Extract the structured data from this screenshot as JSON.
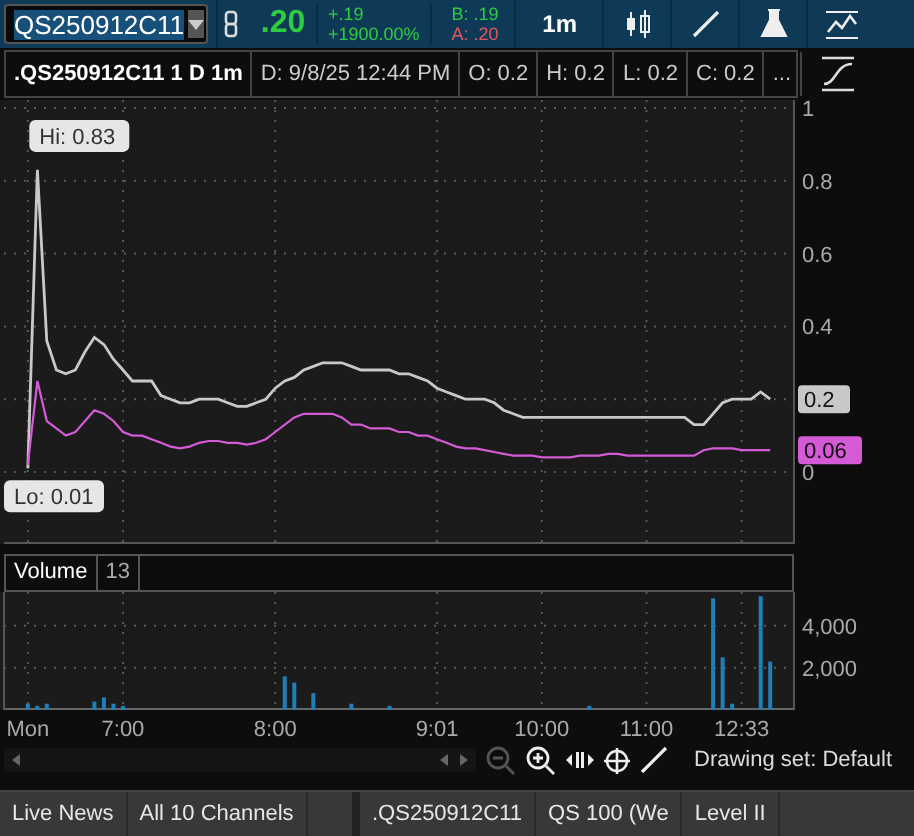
{
  "toolbar": {
    "symbol": "QS250912C11",
    "last": ".20",
    "change": "+.19",
    "change_pct": "+1900.00%",
    "bid": "B: .19",
    "ask": "A: .20",
    "interval": "1m"
  },
  "info_bar": {
    "title": ".QS250912C11 1 D 1m",
    "cells": [
      "D: 9/8/25 12:44 PM",
      "O: 0.2",
      "H: 0.2",
      "L: 0.2",
      "C: 0.2",
      "..."
    ]
  },
  "price_chart": {
    "chart_data": {
      "type": "line",
      "grid": true,
      "ylim": [
        0,
        1
      ],
      "yticks": [
        0,
        0.4,
        0.6,
        0.8,
        1
      ],
      "series": [
        {
          "color": "#c8c8c8",
          "values": [
            0.01,
            0.83,
            0.36,
            0.28,
            0.27,
            0.28,
            0.33,
            0.37,
            0.35,
            0.31,
            0.28,
            0.25,
            0.25,
            0.25,
            0.21,
            0.2,
            0.19,
            0.19,
            0.2,
            0.2,
            0.2,
            0.19,
            0.18,
            0.18,
            0.19,
            0.2,
            0.23,
            0.25,
            0.26,
            0.28,
            0.29,
            0.3,
            0.3,
            0.3,
            0.29,
            0.28,
            0.28,
            0.28,
            0.28,
            0.27,
            0.27,
            0.26,
            0.25,
            0.23,
            0.22,
            0.21,
            0.2,
            0.2,
            0.2,
            0.19,
            0.17,
            0.16,
            0.15,
            0.15,
            0.15,
            0.15,
            0.15,
            0.15,
            0.15,
            0.15,
            0.15,
            0.15,
            0.15,
            0.15,
            0.15,
            0.15,
            0.15,
            0.15,
            0.15,
            0.15,
            0.13,
            0.13,
            0.16,
            0.19,
            0.2,
            0.2,
            0.2,
            0.22,
            0.2
          ]
        },
        {
          "color": "#d45ad6",
          "values": [
            0.02,
            0.25,
            0.14,
            0.12,
            0.1,
            0.11,
            0.14,
            0.17,
            0.16,
            0.14,
            0.11,
            0.1,
            0.1,
            0.09,
            0.08,
            0.07,
            0.065,
            0.07,
            0.08,
            0.085,
            0.085,
            0.08,
            0.08,
            0.075,
            0.08,
            0.09,
            0.11,
            0.13,
            0.15,
            0.16,
            0.16,
            0.16,
            0.16,
            0.15,
            0.13,
            0.13,
            0.12,
            0.12,
            0.12,
            0.11,
            0.11,
            0.1,
            0.1,
            0.09,
            0.08,
            0.07,
            0.065,
            0.065,
            0.06,
            0.055,
            0.05,
            0.045,
            0.045,
            0.045,
            0.04,
            0.04,
            0.04,
            0.04,
            0.045,
            0.045,
            0.045,
            0.05,
            0.05,
            0.045,
            0.045,
            0.045,
            0.045,
            0.045,
            0.045,
            0.045,
            0.045,
            0.06,
            0.065,
            0.065,
            0.065,
            0.06,
            0.06,
            0.06,
            0.06
          ]
        }
      ],
      "annotations": [
        "Hi: 0.83",
        "Lo: 0.01",
        "0.2",
        "0.06"
      ]
    }
  },
  "volume": {
    "label": "Volume",
    "count": "13",
    "chart_data": {
      "type": "bar",
      "grid": true,
      "ylim": [
        0,
        5600
      ],
      "categories": [
        "Mon",
        null,
        null,
        null,
        null,
        null,
        null,
        null,
        null,
        null,
        "7:00",
        null,
        null,
        null,
        null,
        null,
        null,
        null,
        null,
        null,
        null,
        null,
        null,
        null,
        null,
        null,
        "8:00",
        null,
        null,
        null,
        null,
        null,
        null,
        null,
        null,
        null,
        null,
        null,
        null,
        null,
        null,
        null,
        null,
        "9:01",
        null,
        null,
        null,
        null,
        null,
        null,
        null,
        null,
        null,
        null,
        "10:00",
        null,
        null,
        null,
        null,
        null,
        null,
        null,
        null,
        null,
        null,
        "11:00",
        null,
        null,
        null,
        null,
        null,
        null,
        null,
        null,
        null,
        "12:33",
        null,
        null,
        null
      ],
      "yticks": [
        {
          "value": 2000,
          "label": "2,000"
        },
        {
          "value": 4000,
          "label": "4,000"
        }
      ],
      "series": [
        {
          "color": "#1f7fb8",
          "values": [
            300,
            200,
            300,
            0,
            0,
            0,
            0,
            400,
            600,
            300,
            200,
            0,
            0,
            0,
            0,
            0,
            0,
            0,
            0,
            0,
            0,
            0,
            0,
            0,
            0,
            0,
            0,
            1600,
            1300,
            0,
            800,
            0,
            0,
            0,
            300,
            0,
            0,
            0,
            200,
            0,
            0,
            0,
            0,
            0,
            0,
            0,
            0,
            0,
            0,
            0,
            0,
            0,
            0,
            0,
            0,
            0,
            0,
            0,
            0,
            200,
            0,
            0,
            0,
            0,
            0,
            0,
            0,
            0,
            0,
            0,
            0,
            0,
            5300,
            2500,
            300,
            0,
            0,
            5400,
            2300
          ]
        }
      ]
    }
  },
  "drawing_set": "Drawing set: Default",
  "news_tabs": [
    "Live News",
    "All 10 Channels"
  ],
  "symbol_tabs": [
    ".QS250912C11",
    "QS 100 (We",
    "Level II"
  ]
}
